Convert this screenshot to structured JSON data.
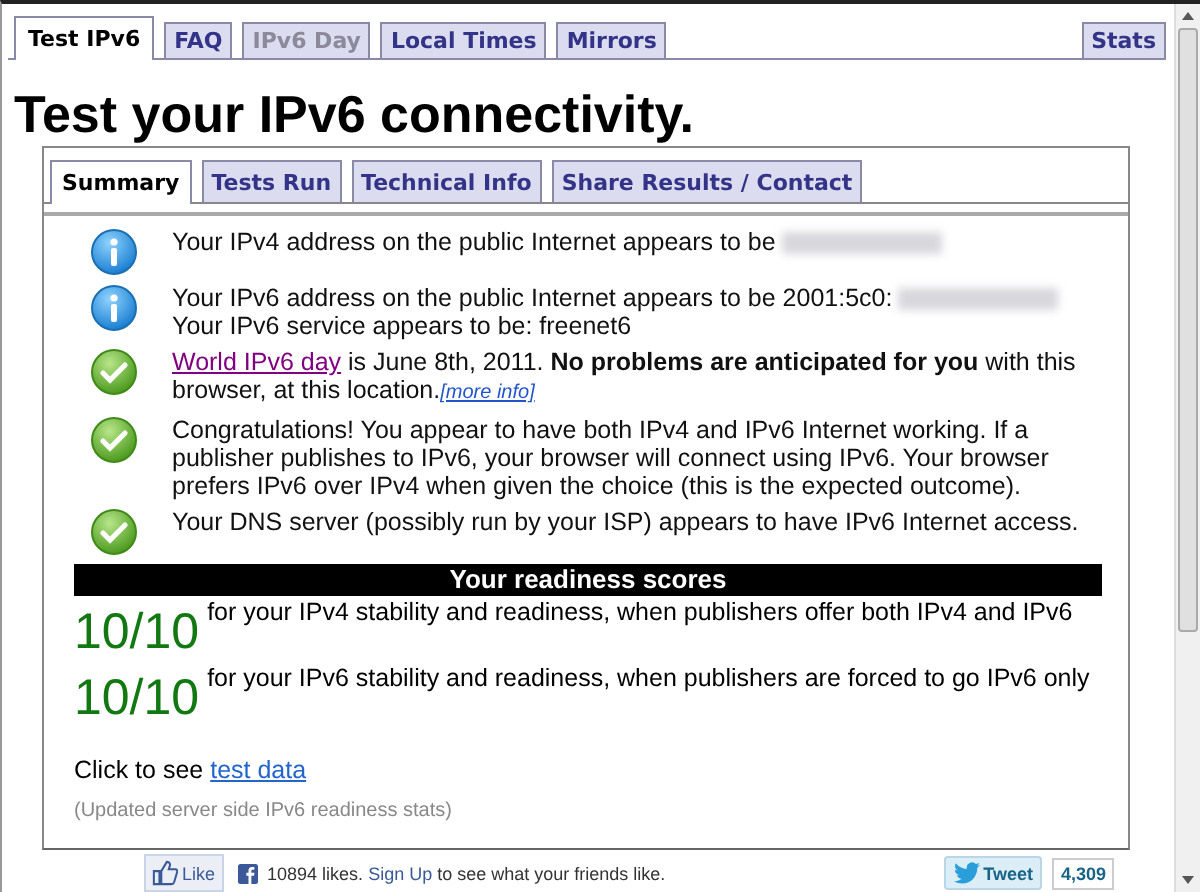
{
  "top_tabs": [
    {
      "label": "Test IPv6",
      "selected": true,
      "disabled": false
    },
    {
      "label": "FAQ",
      "selected": false,
      "disabled": false
    },
    {
      "label": "IPv6 Day",
      "selected": false,
      "disabled": true
    },
    {
      "label": "Local Times",
      "selected": false,
      "disabled": false
    },
    {
      "label": "Mirrors",
      "selected": false,
      "disabled": false
    }
  ],
  "right_tab": {
    "label": "Stats",
    "selected": false
  },
  "heading": "Test your IPv6 connectivity.",
  "sub_tabs": [
    {
      "label": "Summary",
      "selected": true
    },
    {
      "label": "Tests Run",
      "selected": false
    },
    {
      "label": "Technical Info",
      "selected": false
    },
    {
      "label": "Share Results / Contact",
      "selected": false
    }
  ],
  "results": [
    {
      "kind": "info",
      "text": "Your IPv4 address on the public Internet appears to be",
      "redacted": true
    },
    {
      "kind": "info",
      "text": "Your IPv6 address on the public Internet appears to be 2001:5c0:",
      "redacted": true,
      "text2": "Your IPv6 service appears to be: freenet6"
    },
    {
      "kind": "ok",
      "link": "World IPv6 day",
      "text": " is June 8th, 2011. **No problems are anticipated for you** with this browser, at this location.",
      "more": "[more info]"
    },
    {
      "kind": "ok",
      "text": "Congratulations! You appear to have both IPv4 and IPv6 Internet working. If a publisher publishes to IPv6, your browser will connect using IPv6. Your browser prefers IPv6 over IPv4 when given the choice (this is the expected outcome)."
    },
    {
      "kind": "ok",
      "text": "Your DNS server (possibly run by your ISP) appears to have IPv6 Internet access."
    }
  ],
  "scores_title": "Your readiness scores",
  "scores": [
    {
      "score": "10/10",
      "text": "for your IPv4 stability and readiness, when publishers offer both IPv4 and IPv6"
    },
    {
      "score": "10/10",
      "text": "for your IPv6 stability and readiness, when publishers are forced to go IPv6 only"
    }
  ],
  "test_data": {
    "text": "Click to see",
    "link": "test data"
  },
  "note": "(Updated server side IPv6 readiness stats)",
  "footer": {
    "like": "Like",
    "likes": "10894 likes.",
    "signup": "Sign Up",
    "friends": "to see what your friends like.",
    "tweet": "Tweet",
    "tweet_count": "4,309"
  }
}
